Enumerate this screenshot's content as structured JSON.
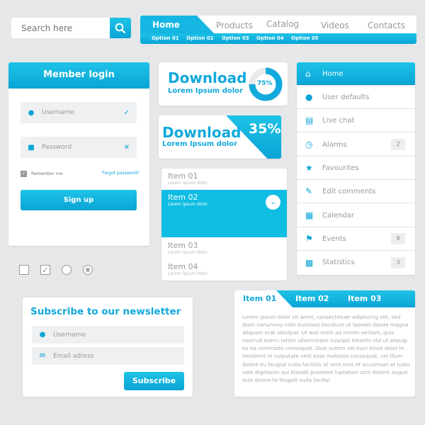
{
  "colors": {
    "accent": "#0aa4d6",
    "background": "#e6e7e9"
  },
  "search": {
    "placeholder": "Search here",
    "icon": "search-icon"
  },
  "nav": {
    "items": [
      "Home",
      "Products",
      "Catalog",
      "Videos",
      "Contacts"
    ],
    "options": [
      "Option 01",
      "Option 02",
      "Option 03",
      "Option 04",
      "Option 05"
    ]
  },
  "login": {
    "title": "Member login",
    "username": "Username",
    "password": "Password",
    "remember": "Remember me",
    "remember_checked": true,
    "forgot": "Forgot password?",
    "signup": "Sign up"
  },
  "controls": {
    "checkbox1": false,
    "checkbox2": true,
    "radio1": false,
    "radio2": true
  },
  "download1": {
    "title": "Download",
    "subtitle": "Lorem Ipsum dolor",
    "progress_label": "75%",
    "progress": 75
  },
  "download2": {
    "title": "Download",
    "subtitle": "Lorem Ipsum dolor",
    "progress_label": "35%"
  },
  "list": {
    "items": [
      {
        "title": "Item 01",
        "sub": "Lorem Ipsum dolor"
      },
      {
        "title": "Item 02",
        "sub": "Lorem Ipsum dolor",
        "active": true
      },
      {
        "title": "Item 03",
        "sub": "Lorem Ipsum dolor"
      },
      {
        "title": "Item 04",
        "sub": "Lorem Ipsum dolor"
      }
    ]
  },
  "menu": {
    "items": [
      {
        "label": "Home",
        "icon": "home-icon"
      },
      {
        "label": "User defaults",
        "icon": "user-icon"
      },
      {
        "label": "Live chat",
        "icon": "chat-icon"
      },
      {
        "label": "Alarms",
        "icon": "clock-icon",
        "badge": "2"
      },
      {
        "label": "Favourites",
        "icon": "star-icon"
      },
      {
        "label": "Edit comments",
        "icon": "pencil-icon"
      },
      {
        "label": "Calendar",
        "icon": "calendar-icon"
      },
      {
        "label": "Events",
        "icon": "flag-icon",
        "badge": "8"
      },
      {
        "label": "Statistics",
        "icon": "chart-icon",
        "badge": "3"
      }
    ]
  },
  "newsletter": {
    "title": "Subscribe to our newsletter",
    "username": "Username",
    "email": "Email adress",
    "button": "Subscribe"
  },
  "tabs": {
    "items": [
      "Item 01",
      "Item 02",
      "Item 03"
    ],
    "body": "Lorem ipsum dolor sit amet, consectetuer adipiscing elit, sed diam nonummy nibh euismod tincidunt ut laoreet dolore magna aliquam erat volutpat. Ut wisi enim ad minim veniam, quis nostrud exerci tation ullamcorper suscipit lobortis nisl ut aliquip ex ea commodo consequat. Duis autem vel eum iriure dolor in hendrerit in vulputate velit esse molestie consequat, vel illum dolore eu feugiat nulla facilisis at vero eros et accumsan et iusto odio dignissim qui blandit praesent luptatum zzril delenit augue duis dolore te feugait nulla facilisi."
  }
}
